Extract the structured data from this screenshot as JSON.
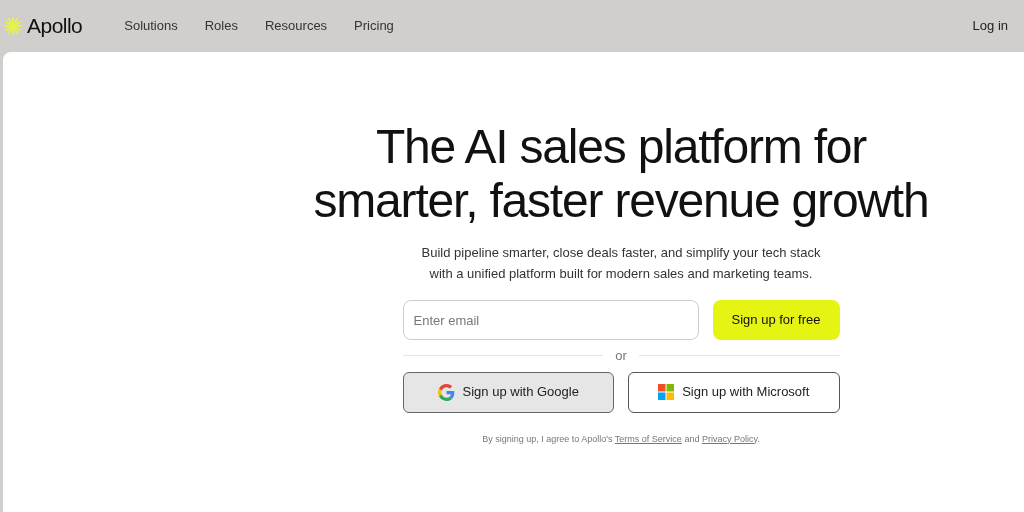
{
  "nav": {
    "logo": "Apollo",
    "links": [
      "Solutions",
      "Roles",
      "Resources",
      "Pricing"
    ],
    "login": "Log in"
  },
  "hero": {
    "heading_lines": [
      "The AI sales platform for",
      "smarter, faster revenue growth"
    ],
    "subheading_lines": [
      "Build pipeline smarter, close deals faster, and simplify your tech stack",
      "with a unified platform built for modern sales and marketing teams."
    ],
    "email": {
      "placeholder": "Enter email"
    },
    "cta": "Sign up for free",
    "divider": "or",
    "social_buttons": [
      {
        "kind": "google",
        "label": "Sign up with Google",
        "hovered": true
      },
      {
        "kind": "microsoft",
        "label": "Sign up with Microsoft",
        "hovered": false
      }
    ],
    "legal": {
      "before": "By signing up, I agree to Apollo's",
      "terms": "Terms of Service",
      "middle": "and",
      "privacy": "Privacy Policy",
      "after": "."
    }
  }
}
